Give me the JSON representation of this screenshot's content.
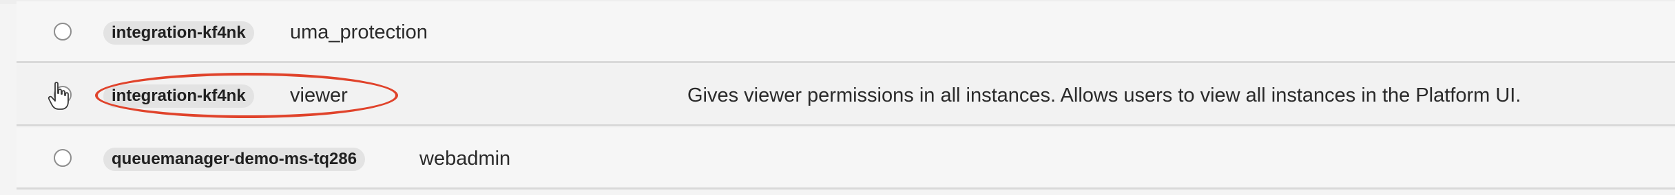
{
  "roles": [
    {
      "client": "integration-kf4nk",
      "role": "uma_protection",
      "description": ""
    },
    {
      "client": "integration-kf4nk",
      "role": "viewer",
      "description": "Gives viewer permissions in all instances. Allows users to view all instances in the Platform UI."
    },
    {
      "client": "queuemanager-demo-ms-tq286",
      "role": "webadmin",
      "description": ""
    }
  ],
  "annotation": {
    "color": "#e0432b"
  },
  "icons": {
    "cursor": "hand-pointer-icon"
  }
}
